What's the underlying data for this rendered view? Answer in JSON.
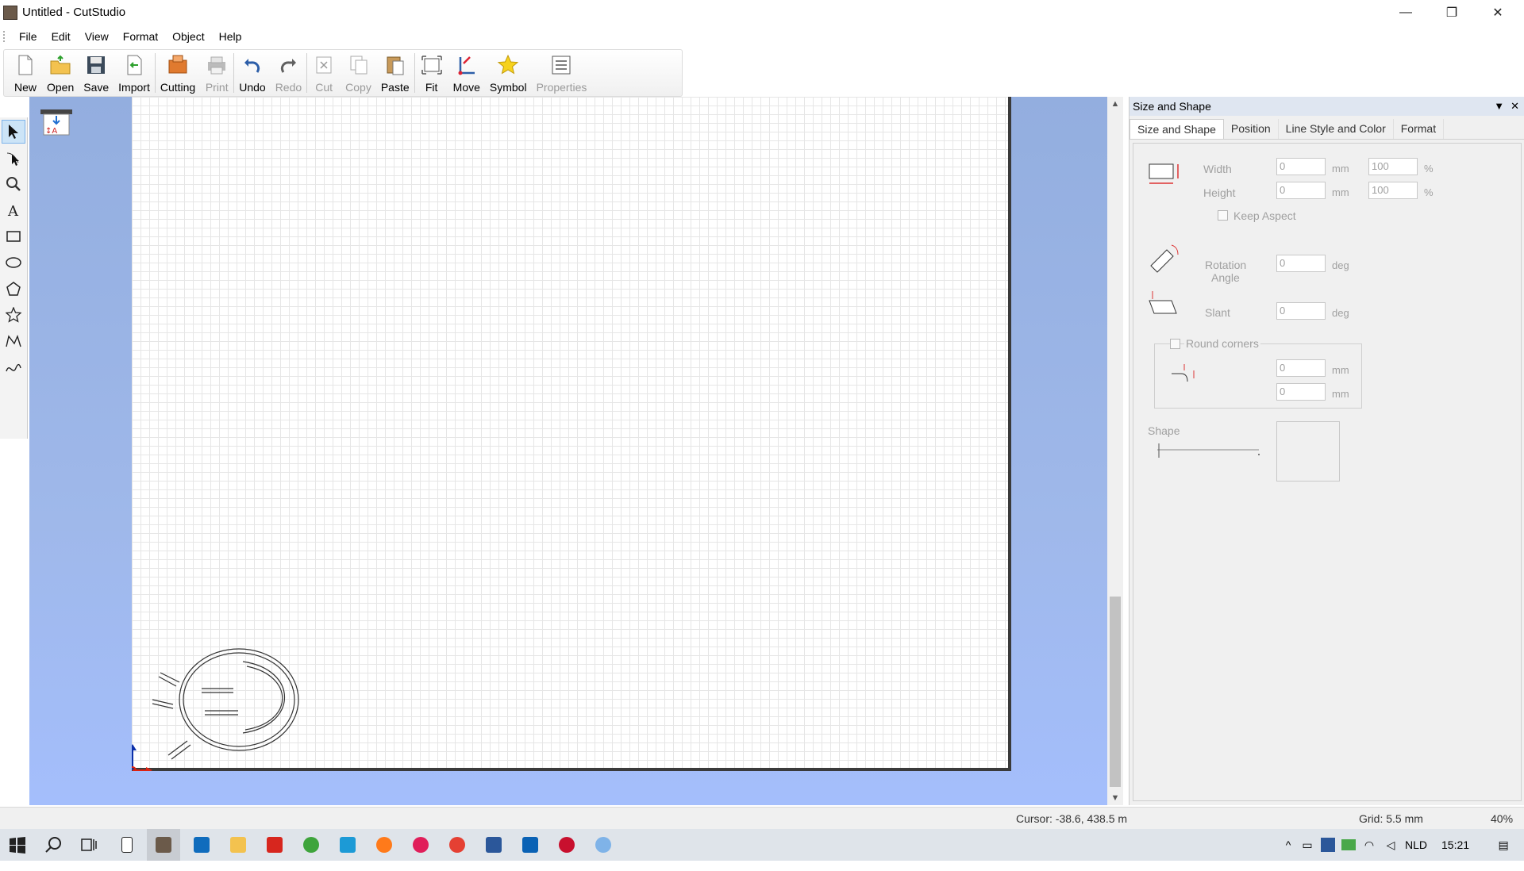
{
  "window": {
    "title": "Untitled - CutStudio",
    "minimize": "—",
    "maximize": "❐",
    "close": "✕"
  },
  "menu": [
    "File",
    "Edit",
    "View",
    "Format",
    "Object",
    "Help"
  ],
  "toolbar": [
    {
      "label": "New",
      "icon": "new-doc-icon",
      "enabled": true
    },
    {
      "label": "Open",
      "icon": "open-folder-icon",
      "enabled": true
    },
    {
      "label": "Save",
      "icon": "save-disk-icon",
      "enabled": true
    },
    {
      "label": "Import",
      "icon": "import-icon",
      "enabled": true
    },
    {
      "label": "Cutting",
      "icon": "cutting-icon",
      "enabled": true
    },
    {
      "label": "Print",
      "icon": "print-icon",
      "enabled": false
    },
    {
      "label": "Undo",
      "icon": "undo-icon",
      "enabled": true
    },
    {
      "label": "Redo",
      "icon": "redo-icon",
      "enabled": false
    },
    {
      "label": "Cut",
      "icon": "cut-icon",
      "enabled": false
    },
    {
      "label": "Copy",
      "icon": "copy-icon",
      "enabled": false
    },
    {
      "label": "Paste",
      "icon": "paste-icon",
      "enabled": true
    },
    {
      "label": "Fit",
      "icon": "fit-icon",
      "enabled": true
    },
    {
      "label": "Move",
      "icon": "move-icon",
      "enabled": true
    },
    {
      "label": "Symbol",
      "icon": "star-symbol-icon",
      "enabled": true
    },
    {
      "label": "Properties",
      "icon": "properties-icon",
      "enabled": false
    }
  ],
  "tools": [
    "select-arrow-icon",
    "edit-points-icon",
    "zoom-icon",
    "text-tool-icon",
    "rectangle-tool-icon",
    "ellipse-tool-icon",
    "polygon-tool-icon",
    "star-tool-icon",
    "polyline-tool-icon",
    "curve-tool-icon"
  ],
  "panel": {
    "title": "Size and Shape",
    "tabs": [
      "Size and Shape",
      "Position",
      "Line Style and Color",
      "Format"
    ],
    "width_label": "Width",
    "height_label": "Height",
    "width_value": "0",
    "height_value": "0",
    "width_pct": "100",
    "height_pct": "100",
    "unit_mm": "mm",
    "unit_pct": "%",
    "keep_aspect": "Keep Aspect",
    "rotation_label_1": "Rotation",
    "rotation_label_2": "Angle",
    "rotation_value": "0",
    "unit_deg": "deg",
    "slant_label": "Slant",
    "slant_value": "0",
    "round_corners": "Round corners",
    "corner_x": "0",
    "corner_y": "0",
    "shape_label": "Shape"
  },
  "status": {
    "cursor": "Cursor: -38.6, 438.5 m",
    "grid": "Grid: 5.5 mm",
    "zoom": "40%"
  },
  "taskbar": {
    "lang": "NLD",
    "time": "15:21"
  },
  "colors": {
    "workarea": "#9fb8ea",
    "accent": "#0078d7"
  }
}
